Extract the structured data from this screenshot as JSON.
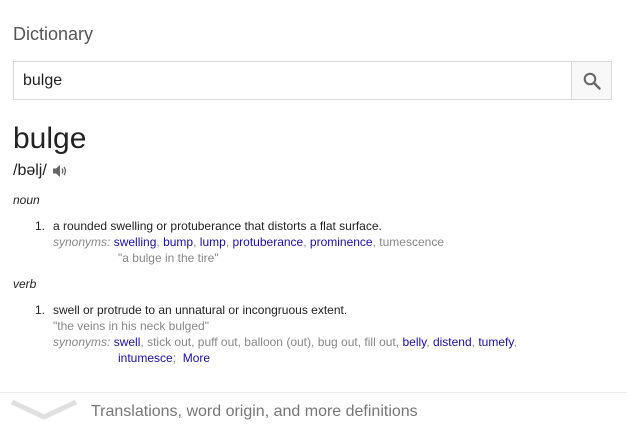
{
  "panel": {
    "title": "Dictionary"
  },
  "search": {
    "value": "bulge",
    "button_icon": "search-icon"
  },
  "entry": {
    "word": "bulge",
    "phonetic": "/bəlj/",
    "audio_icon": "speaker-icon",
    "noun": {
      "label": "noun",
      "num": "1.",
      "definition": "a rounded swelling or protuberance that distorts a flat surface.",
      "synonyms_label": "synonyms:",
      "synonyms": [
        {
          "text": "swelling",
          "linked": true
        },
        {
          "text": "bump",
          "linked": true
        },
        {
          "text": "lump",
          "linked": true
        },
        {
          "text": "protuberance",
          "linked": true
        },
        {
          "text": "prominence",
          "linked": true
        },
        {
          "text": "tumescence",
          "linked": false
        }
      ],
      "example": "\"a bulge in the tire\""
    },
    "verb": {
      "label": "verb",
      "num": "1.",
      "definition": "swell or protrude to an unnatural or incongruous extent.",
      "example": "\"the veins in his neck bulged\"",
      "synonyms_label": "synonyms:",
      "synonyms_line1": [
        {
          "text": "swell",
          "linked": true
        },
        {
          "text": "stick out",
          "linked": false
        },
        {
          "text": "puff out",
          "linked": false
        },
        {
          "text": "balloon (out)",
          "linked": false
        },
        {
          "text": "bug out",
          "linked": false
        },
        {
          "text": "fill out",
          "linked": false
        },
        {
          "text": "belly",
          "linked": true
        },
        {
          "text": "distend",
          "linked": true
        },
        {
          "text": "tumefy",
          "linked": true
        }
      ],
      "synonyms_line2": [
        {
          "text": "intumesce",
          "linked": true
        }
      ],
      "more": "More"
    }
  },
  "footer": {
    "text": "Translations, word origin, and more definitions",
    "icon": "chevron-down-icon"
  },
  "colors": {
    "link": "#1a0dab",
    "muted": "#878787"
  }
}
